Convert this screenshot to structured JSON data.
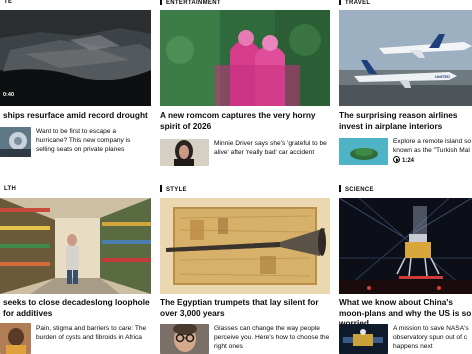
{
  "row1": {
    "col1": {
      "section": "TE",
      "video_time": "0:40",
      "headline": "ships resurface amid record drought",
      "sub": "Want to be first to escape a hurricane? This new company is selling seats on private planes"
    },
    "col2": {
      "section": "ENTERTAINMENT",
      "headline": "A new romcom captures the very horny spirit of 2026",
      "sub": "Minnie Driver says she's 'grateful to be alive' after 'really bad' car accident"
    },
    "col3": {
      "section": "TRAVEL",
      "headline": "The surprising reason airlines invest in airplane interiors",
      "sub": "Explore a remote island so known as the \"Turkish Mal",
      "sub_duration": "1:24"
    }
  },
  "row2": {
    "col1": {
      "section": "LTH",
      "headline": "seeks to close decadeslong loophole for additives",
      "sub": "Pain, stigma and barriers to care: The burden of cysts and fibroids in Africa"
    },
    "col2": {
      "section": "STYLE",
      "headline": "The Egyptian trumpets that lay silent for over 3,000 years",
      "sub": "Glasses can change the way people perceive you. Here's how to choose the right ones"
    },
    "col3": {
      "section": "SCIENCE",
      "headline": "What we know about China's moon-plans and why the US is so worried",
      "sub": "A mission to save NASA's observatory spun out of c happens next"
    }
  },
  "plane_text": "UNITED"
}
